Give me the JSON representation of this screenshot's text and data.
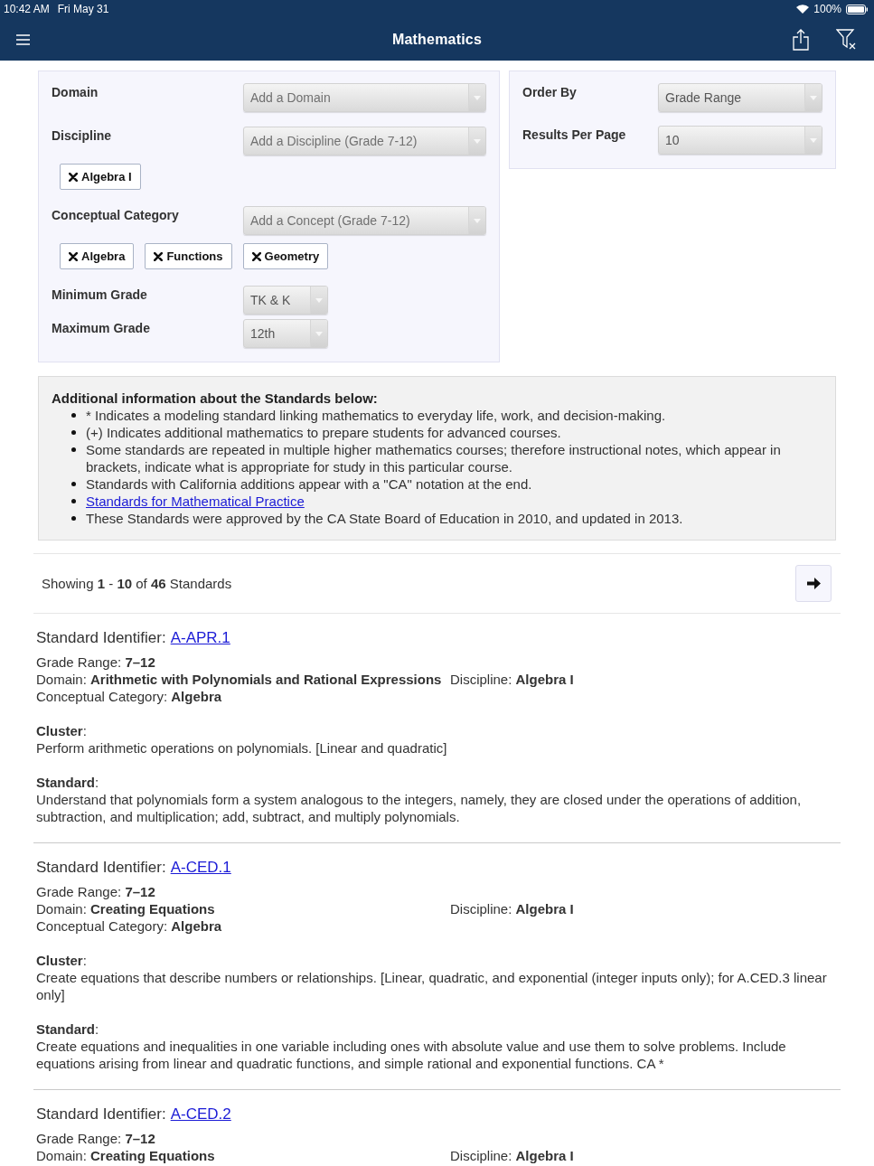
{
  "status_bar": {
    "time": "10:42 AM",
    "date": "Fri May 31",
    "battery": "100%"
  },
  "nav_bar": {
    "title": "Mathematics"
  },
  "filters": {
    "fields": [
      {
        "label": "Domain",
        "placeholder": "Add a Domain",
        "kind": "wide"
      },
      {
        "label": "Discipline",
        "placeholder": "Add a Discipline (Grade 7-12)",
        "kind": "wide",
        "tags": [
          "Algebra I"
        ]
      },
      {
        "label": "Conceptual Category",
        "placeholder": "Add a Concept (Grade 7-12)",
        "kind": "wide",
        "tags": [
          "Algebra",
          "Functions",
          "Geometry"
        ]
      },
      {
        "label": "Minimum Grade",
        "value": "TK & K",
        "kind": "short"
      },
      {
        "label": "Maximum Grade",
        "value": "12th",
        "kind": "short"
      }
    ]
  },
  "sort": {
    "fields": [
      {
        "label": "Order By",
        "value": "Grade Range"
      },
      {
        "label": "Results Per Page",
        "value": "10"
      }
    ]
  },
  "info": {
    "title": "Additional information about the Standards below:",
    "bullets": [
      {
        "kind": "text",
        "text": "* Indicates a modeling standard linking mathematics to everyday life, work, and decision-making."
      },
      {
        "kind": "text",
        "text": "(+) Indicates additional mathematics to prepare students for advanced courses."
      },
      {
        "kind": "text",
        "text": "Some standards are repeated in multiple higher mathematics courses; therefore instructional notes, which appear in brackets, indicate what is appropriate for study in this particular course."
      },
      {
        "kind": "text",
        "text": "Standards with California additions appear with a \"CA\" notation at the end."
      },
      {
        "kind": "link",
        "text": "Standards for Mathematical Practice"
      },
      {
        "kind": "text",
        "text": "These Standards were approved by the CA State Board of Education in 2010, and updated in 2013."
      }
    ]
  },
  "pagination": {
    "summary": "Showing **1** - **10** of **46** Standards"
  },
  "standards": [
    {
      "heading": "Standard Identifier:",
      "identifier": "A-APR.1",
      "grade_range": "Grade Range: **7–12**",
      "domain": "Domain: **Arithmetic with Polynomials and Rational Expressions**",
      "discipline": "Discipline: **Algebra I**",
      "conceptual_category": "Conceptual Category: **Algebra**",
      "cluster_label": "**Cluster**:",
      "cluster": "Perform arithmetic operations on polynomials. [Linear and quadratic]",
      "standard_label": "**Standard**:",
      "standard": "Understand that polynomials form a system analogous to the integers, namely, they are closed under the operations of addition, subtraction, and multiplication; add, subtract, and multiply polynomials."
    },
    {
      "heading": "Standard Identifier:",
      "identifier": "A-CED.1",
      "grade_range": "Grade Range: **7–12**",
      "domain": "Domain: **Creating Equations**",
      "discipline": "Discipline: **Algebra I**",
      "conceptual_category": "Conceptual Category: **Algebra**",
      "cluster_label": "**Cluster**:",
      "cluster": "Create equations that describe numbers or relationships. [Linear, quadratic, and exponential (integer inputs only); for A.CED.3 linear only]",
      "standard_label": "**Standard**:",
      "standard": "Create equations and inequalities in one variable including ones with absolute value and use them to solve problems. Include equations arising from linear and quadratic functions, and simple rational and exponential functions. CA *"
    },
    {
      "heading": "Standard Identifier:",
      "identifier": "A-CED.2",
      "grade_range": "Grade Range: **7–12**",
      "domain": "Domain: **Creating Equations**",
      "discipline": "Discipline: **Algebra I**"
    }
  ]
}
